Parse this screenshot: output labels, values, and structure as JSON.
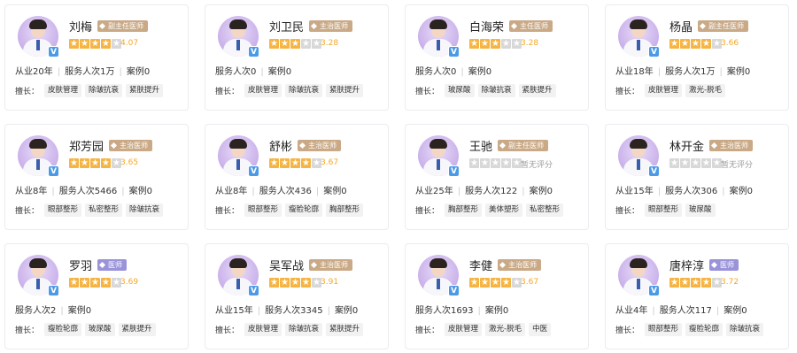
{
  "tags_label": "擅长：",
  "doctors": [
    {
      "name": "刘梅",
      "title": "副主任医师",
      "rating": "4.07",
      "stars": 4,
      "stats": [
        "从业20年",
        "服务人次1万",
        "案例0"
      ],
      "tags": [
        "皮肤管理",
        "除皱抗衰",
        "紧肤提升"
      ]
    },
    {
      "name": "刘卫民",
      "title": "主治医师",
      "rating": "3.28",
      "stars": 3,
      "stats": [
        "服务人次0",
        "案例0"
      ],
      "tags": [
        "皮肤管理",
        "除皱抗衰",
        "紧肤提升"
      ]
    },
    {
      "name": "白海荣",
      "title": "主任医师",
      "rating": "3.28",
      "stars": 3,
      "stats": [
        "服务人次0",
        "案例0"
      ],
      "tags": [
        "玻尿酸",
        "除皱抗衰",
        "紧肤提升"
      ]
    },
    {
      "name": "杨晶",
      "title": "副主任医师",
      "rating": "3.66",
      "stars": 4,
      "stats": [
        "从业18年",
        "服务人次1万",
        "案例0"
      ],
      "tags": [
        "皮肤管理",
        "激光-脱毛"
      ]
    },
    {
      "name": "郑芳园",
      "title": "主治医师",
      "rating": "3.65",
      "stars": 4,
      "stats": [
        "从业8年",
        "服务人次5466",
        "案例0"
      ],
      "tags": [
        "眼部整形",
        "私密整形",
        "除皱抗衰"
      ]
    },
    {
      "name": "舒彬",
      "title": "主治医师",
      "rating": "3.67",
      "stars": 4,
      "stats": [
        "从业8年",
        "服务人次436",
        "案例0"
      ],
      "tags": [
        "眼部整形",
        "瘦脸轮廓",
        "胸部整形"
      ]
    },
    {
      "name": "王驰",
      "title": "副主任医师",
      "rating": "暂无评分",
      "stars": 0,
      "stats": [
        "从业25年",
        "服务人次122",
        "案例0"
      ],
      "tags": [
        "胸部整形",
        "美体塑形",
        "私密整形"
      ]
    },
    {
      "name": "林开金",
      "title": "主治医师",
      "rating": "暂无评分",
      "stars": 0,
      "stats": [
        "从业15年",
        "服务人次306",
        "案例0"
      ],
      "tags": [
        "眼部整形",
        "玻尿酸"
      ]
    },
    {
      "name": "罗羽",
      "title": "医师",
      "rating": "3.69",
      "stars": 4,
      "stats": [
        "服务人次2",
        "案例0"
      ],
      "tags": [
        "瘦脸轮廓",
        "玻尿酸",
        "紧肤提升"
      ]
    },
    {
      "name": "吴军战",
      "title": "主治医师",
      "rating": "3.91",
      "stars": 4,
      "stats": [
        "从业15年",
        "服务人次3345",
        "案例0"
      ],
      "tags": [
        "皮肤管理",
        "除皱抗衰",
        "紧肤提升"
      ]
    },
    {
      "name": "李健",
      "title": "主治医师",
      "rating": "3.67",
      "stars": 4,
      "stats": [
        "服务人次1693",
        "案例0"
      ],
      "tags": [
        "皮肤管理",
        "激光-脱毛",
        "中医"
      ]
    },
    {
      "name": "唐梓淳",
      "title": "医师",
      "rating": "3.72",
      "stars": 4,
      "stats": [
        "从业4年",
        "服务人次117",
        "案例0"
      ],
      "tags": [
        "眼部整形",
        "瘦脸轮廓",
        "除皱抗衰"
      ]
    }
  ]
}
